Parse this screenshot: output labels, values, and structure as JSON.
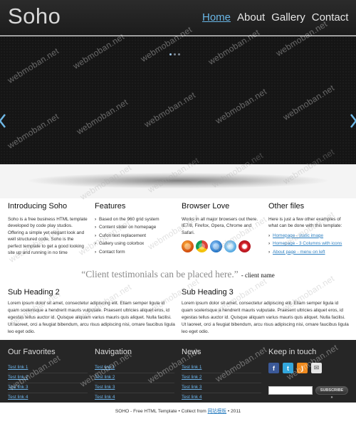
{
  "site": {
    "logo": "Soho",
    "nav": [
      "Home",
      "About",
      "Gallery",
      "Contact"
    ],
    "active_nav": "Home"
  },
  "columns": {
    "intro": {
      "title": "Introducing Soho",
      "text": "Soho is a free business HTML template developed by code play studios. Offering a simple yet elegant look and well structured code, Soho is the perfect template to get a good looking site up and running in no time"
    },
    "features": {
      "title": "Features",
      "items": [
        "Based on the 960 grid system",
        "Content slider on homepage",
        "Cufon text replacement",
        "Gallery using colorbox",
        "Contact form"
      ]
    },
    "browser": {
      "title": "Browser Love",
      "text": "Works in all major browsers out there. IE7/8, Firefox, Opera, Chrome and Safari."
    },
    "other": {
      "title": "Other files",
      "text": "Here is just a few other examples of what can be done with this template:",
      "links": [
        "Homepage - static image",
        "Homepage - 3 Columns with icons",
        "About page - menu on left"
      ]
    }
  },
  "testimonial": {
    "quote": "“Client testimonials can be placed here.”",
    "author": "- client name"
  },
  "subsections": [
    {
      "title": "Sub Heading 2",
      "text": "Lorem ipsum dolor sit amet, consectetur adipiscing elit. Etiam semper ligula id quam scelerisque a hendrerit mauris vulputate. Praesent ultricies aliquet eros, id egestas tellus auctor id. Quisque aliquam varius mauris quis aliquet. Nulla facilisi. Ut laoreet, orci a feugiat bibendum, arcu risus adipiscing nisi, ornare faucibus ligula leo eget odio."
    },
    {
      "title": "Sub Heading 3",
      "text": "Lorem ipsum dolor sit amet, consectetur adipiscing elit. Etiam semper ligula id quam scelerisque a hendrerit mauris vulputate. Praesent ultricies aliquet eros, id egestas tellus auctor id. Quisque aliquam varius mauris quis aliquet. Nulla facilisi. Ut laoreet, orci a feugiat bibendum, arcu risus adipiscing nisi, ornare faucibus ligula leo eget odio."
    }
  ],
  "footer": {
    "favorites": {
      "title": "Our Favorites",
      "links": [
        "Test link 1",
        "Test link 2",
        "Test link 3",
        "Test link 4"
      ]
    },
    "navigation": {
      "title": "Navigation",
      "links": [
        "Test link 1",
        "Test link 2",
        "Test link 3",
        "Test link 4"
      ]
    },
    "news": {
      "title": "News",
      "links": [
        "Test link 1",
        "Test link 2",
        "Test link 3",
        "Test link 4"
      ]
    },
    "keep_in_touch": {
      "title": "Keep in touch",
      "subscribe_label": "SUBSCRIBE »",
      "social": [
        "facebook-icon",
        "twitter-icon",
        "rss-icon",
        "mail-icon"
      ]
    }
  },
  "bottom": {
    "prefix": "SOHO - Free HTML Template • Collect from ",
    "link": "网站模板",
    "suffix": " • 2011"
  },
  "watermark": "webmoban.net",
  "colors": {
    "accent": "#69b6e6",
    "link": "#2c7fc1",
    "footer_bg": "#262626",
    "header_bg": "#1c1c1c"
  }
}
